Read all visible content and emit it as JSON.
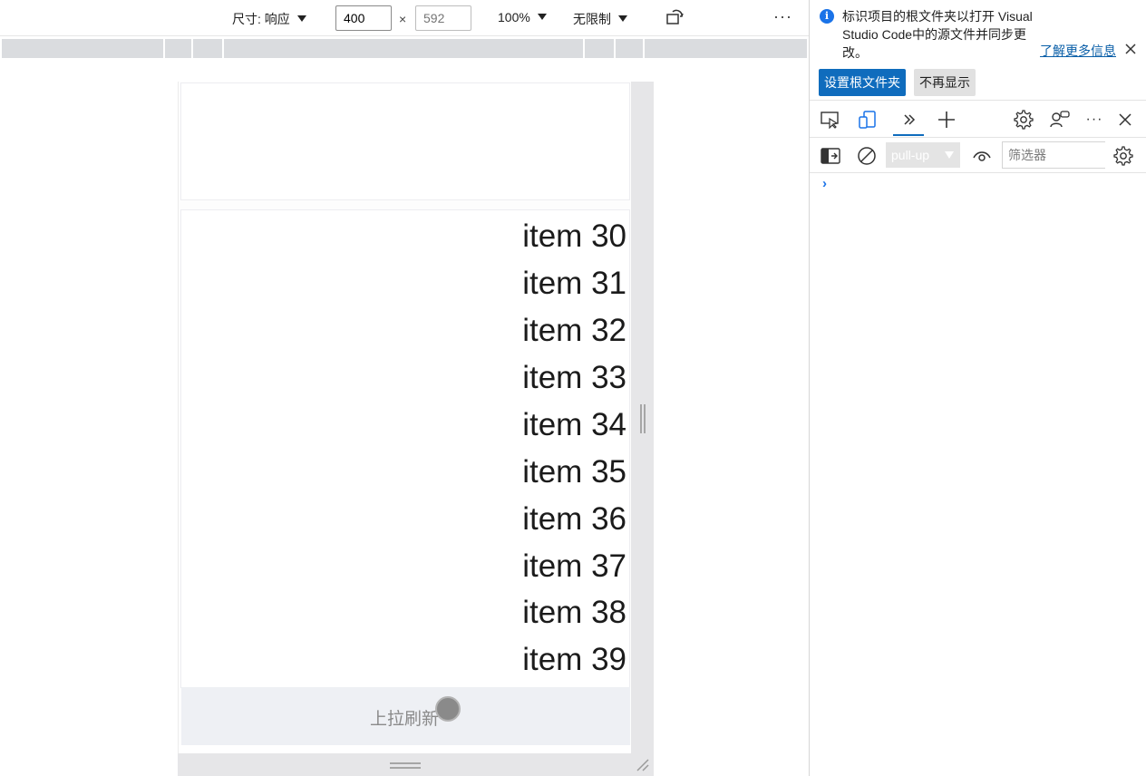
{
  "device_toolbar": {
    "dimensions_label": "尺寸: 响应",
    "width_value": "400",
    "height_placeholder": "592",
    "times": "×",
    "zoom_label": "100%",
    "throttle_label": "无限制",
    "more_label": "···"
  },
  "page": {
    "list_items": [
      "item 30",
      "item 31",
      "item 32",
      "item 33",
      "item 34",
      "item 35",
      "item 36",
      "item 37",
      "item 38",
      "item 39"
    ],
    "pull_up_text": "上拉刷新"
  },
  "devtools": {
    "banner": {
      "message": "标识项目的根文件夹以打开 Visual Studio Code中的源文件并同步更改。",
      "learn_more": "了解更多信息",
      "set_root_button": "设置根文件夹",
      "dont_show_button": "不再显示"
    },
    "console": {
      "context": "pull-up",
      "filter_placeholder": "筛选器",
      "prompt": "›"
    }
  },
  "colors": {
    "accent": "#0f6cbd",
    "info": "#1a73e8",
    "footer_bg": "#eef0f4"
  }
}
